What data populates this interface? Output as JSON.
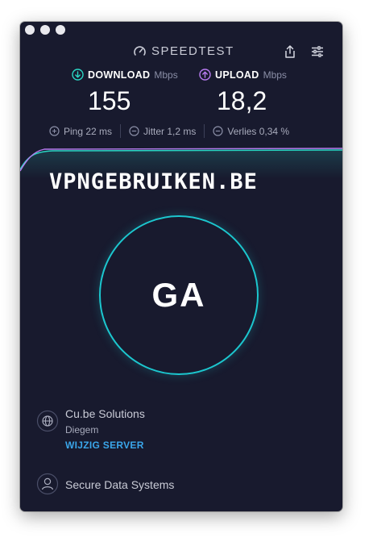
{
  "app": {
    "brand": "SPEEDTEST"
  },
  "metrics": {
    "download": {
      "label": "DOWNLOAD",
      "unit": "Mbps",
      "value": "155",
      "icon": "download-arrow-icon",
      "color": "#2ad6c4"
    },
    "upload": {
      "label": "UPLOAD",
      "unit": "Mbps",
      "value": "18,2",
      "icon": "upload-arrow-icon",
      "color": "#b77bf0"
    }
  },
  "stats": {
    "ping": "Ping 22 ms",
    "jitter": "Jitter 1,2 ms",
    "loss": "Verlies 0,34 %"
  },
  "watermark": "VPNGEBRUIKEN.BE",
  "go": {
    "label": "GA",
    "ring_color": "#1cc7cf"
  },
  "server": {
    "name": "Cu.be Solutions",
    "location": "Diegem",
    "change_label": "WIJZIG SERVER",
    "icon": "globe-icon"
  },
  "provider": {
    "name": "Secure Data Systems",
    "icon": "person-icon"
  },
  "colors": {
    "background": "#181a2e",
    "link": "#3aa6ea"
  }
}
